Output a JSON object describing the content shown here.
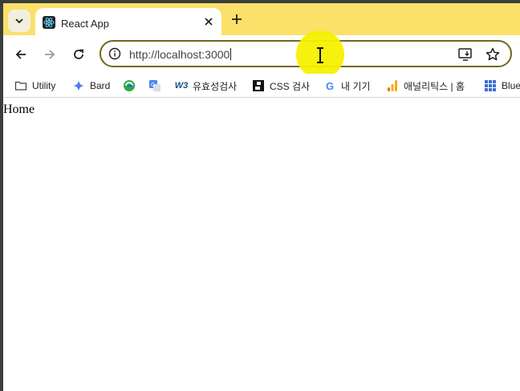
{
  "tab": {
    "title": "React App",
    "favicon": "react-icon"
  },
  "toolbar": {
    "url": "http://localhost:3000"
  },
  "bookmarks": [
    {
      "label": "Utility",
      "icon": "folder-icon"
    },
    {
      "label": "Bard",
      "icon": "bard-icon"
    },
    {
      "label": "",
      "icon": "edge-app-icon"
    },
    {
      "label": "",
      "icon": "translate-icon"
    },
    {
      "label": "유효성검사",
      "icon": "w3c-icon"
    },
    {
      "label": "CSS 검사",
      "icon": "css-icon"
    },
    {
      "label": "내 기기",
      "icon": "google-icon"
    },
    {
      "label": "애널리틱스 | 홈",
      "icon": "analytics-icon"
    },
    {
      "label": "Blue",
      "icon": "apps-grid-icon"
    }
  ],
  "page": {
    "heading": "Home"
  },
  "colors": {
    "tabstrip": "#fbe06a",
    "omnibox_border": "#6f6a1c",
    "cursor_highlight": "#f5f000"
  }
}
